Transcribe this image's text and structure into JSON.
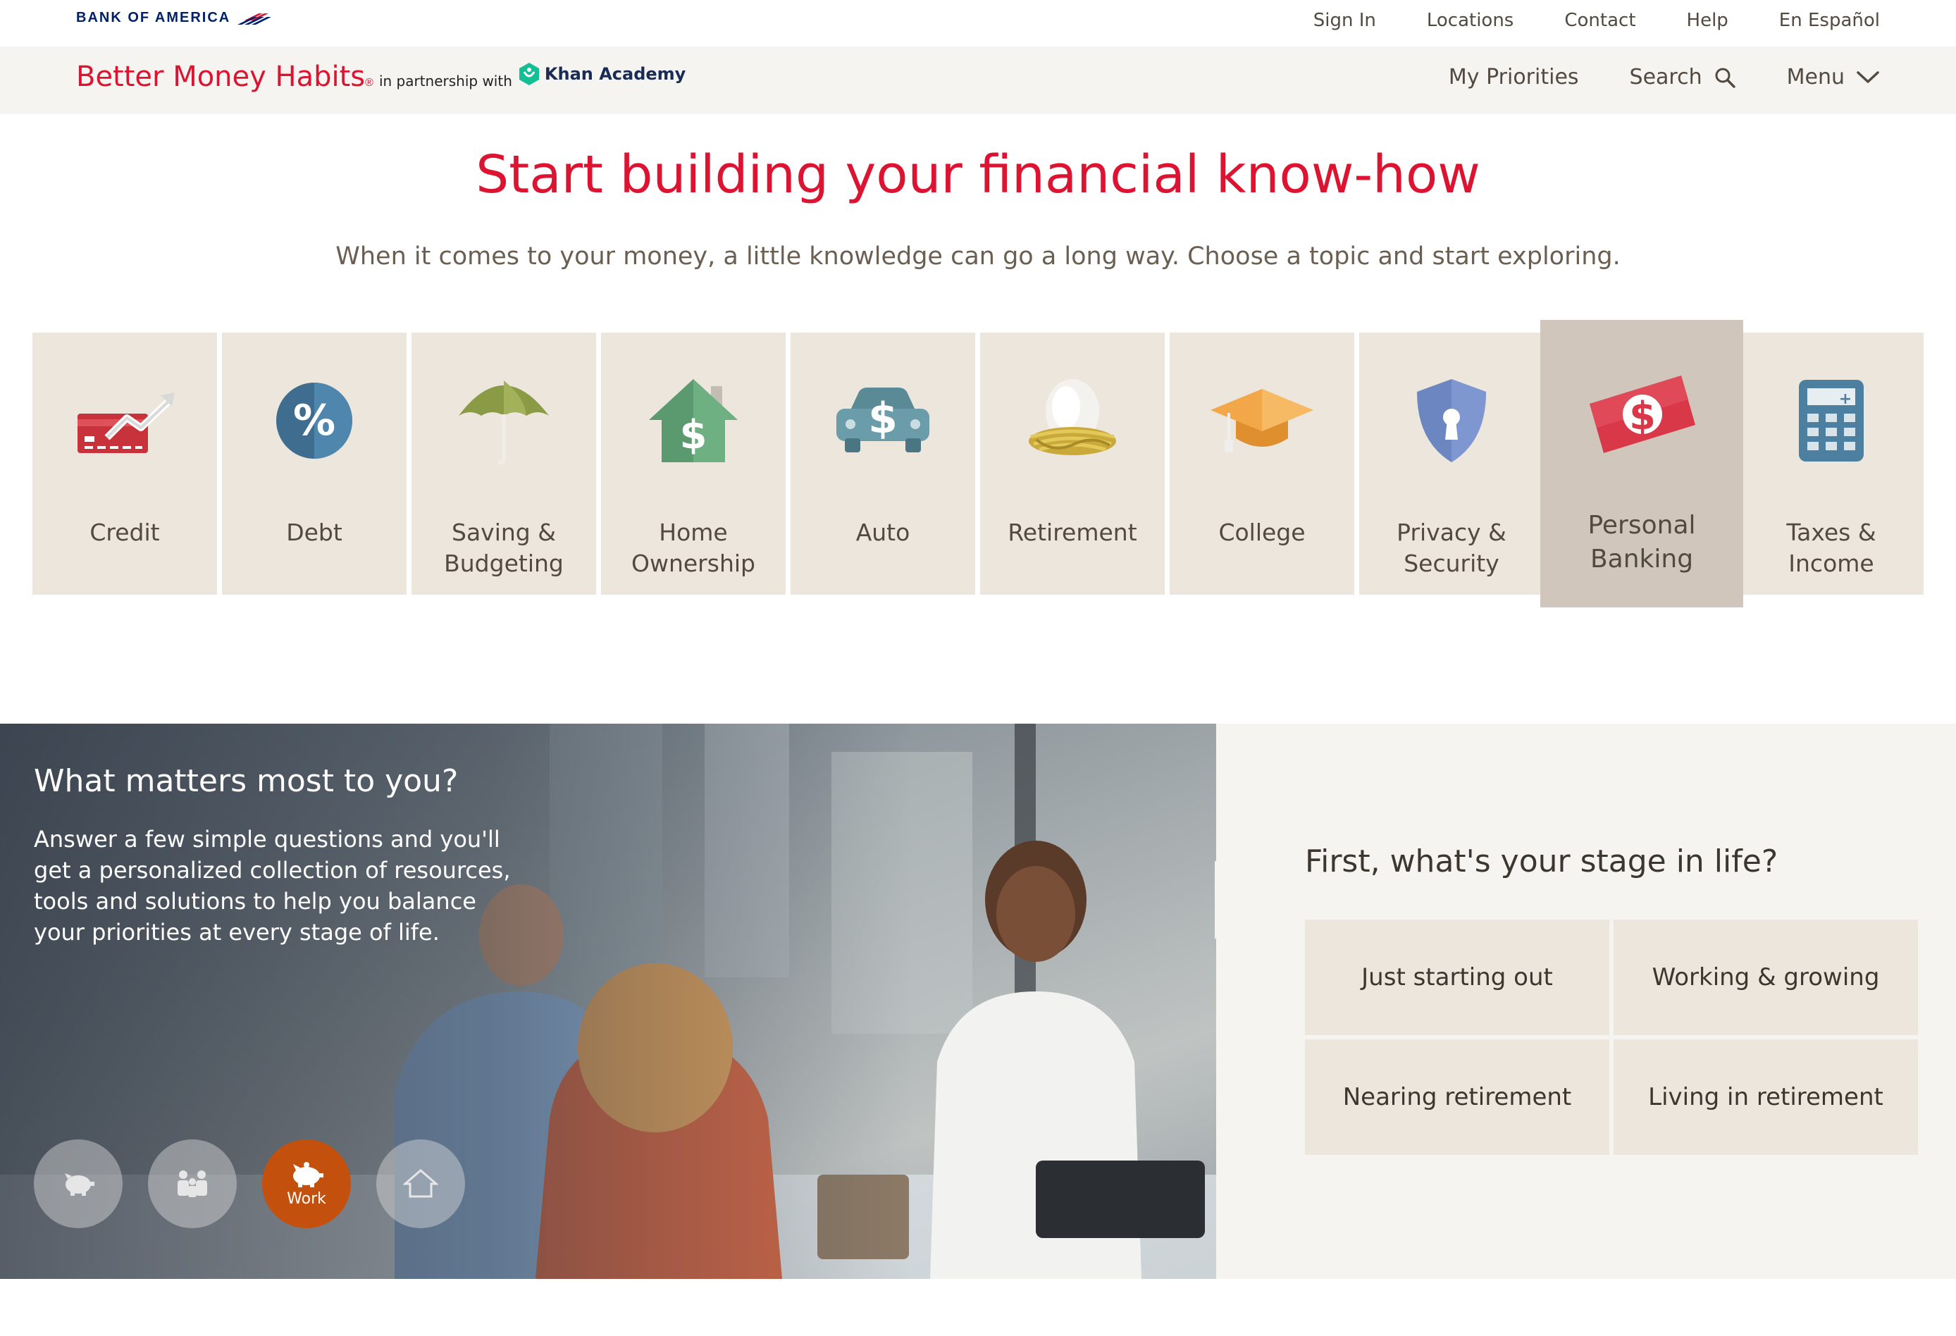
{
  "utility": {
    "logo_text": "BANK OF AMERICA",
    "links": [
      "Sign In",
      "Locations",
      "Contact",
      "Help",
      "En Español"
    ]
  },
  "nav": {
    "brand": "Better Money Habits",
    "brand_reg": "®",
    "partner_text": "in partnership with",
    "partner_name": "Khan Academy",
    "my_priorities": "My Priorities",
    "search": "Search",
    "menu": "Menu"
  },
  "hero": {
    "title": "Start building your financial know-how",
    "subtitle": "When it comes to your money, a little knowledge can go a long way. Choose a topic and start exploring."
  },
  "topics": [
    {
      "label": "Credit",
      "icon": "credit-card-icon"
    },
    {
      "label": "Debt",
      "icon": "percent-icon"
    },
    {
      "label": "Saving & Budgeting",
      "icon": "umbrella-icon"
    },
    {
      "label": "Home Ownership",
      "icon": "house-dollar-icon"
    },
    {
      "label": "Auto",
      "icon": "car-dollar-icon"
    },
    {
      "label": "Retirement",
      "icon": "nest-egg-icon"
    },
    {
      "label": "College",
      "icon": "graduation-cap-icon"
    },
    {
      "label": "Privacy & Security",
      "icon": "shield-lock-icon"
    },
    {
      "label": "Personal Banking",
      "icon": "dollar-bill-icon"
    },
    {
      "label": "Taxes & Income",
      "icon": "calculator-icon"
    }
  ],
  "priorities": {
    "question": "What matters most to you?",
    "body": "Answer a few simple questions and you'll get a personalized collection of resources, tools and solutions to help you balance your priorities at every stage of life.",
    "circles": [
      {
        "icon": "piggy-bank-icon",
        "label": ""
      },
      {
        "icon": "family-icon",
        "label": ""
      },
      {
        "icon": "piggy-bank-icon",
        "label": "Work"
      },
      {
        "icon": "home-icon",
        "label": ""
      }
    ],
    "stage_question": "First, what's your stage in life?",
    "stages": [
      "Just starting out",
      "Working & growing",
      "Nearing retirement",
      "Living in retirement"
    ]
  },
  "colors": {
    "brand_red": "#dc1431",
    "tile_bg": "#ede6dc",
    "tile_active_bg": "#d1c6bb",
    "work_orange": "#c4500e",
    "boa_navy": "#012169"
  }
}
